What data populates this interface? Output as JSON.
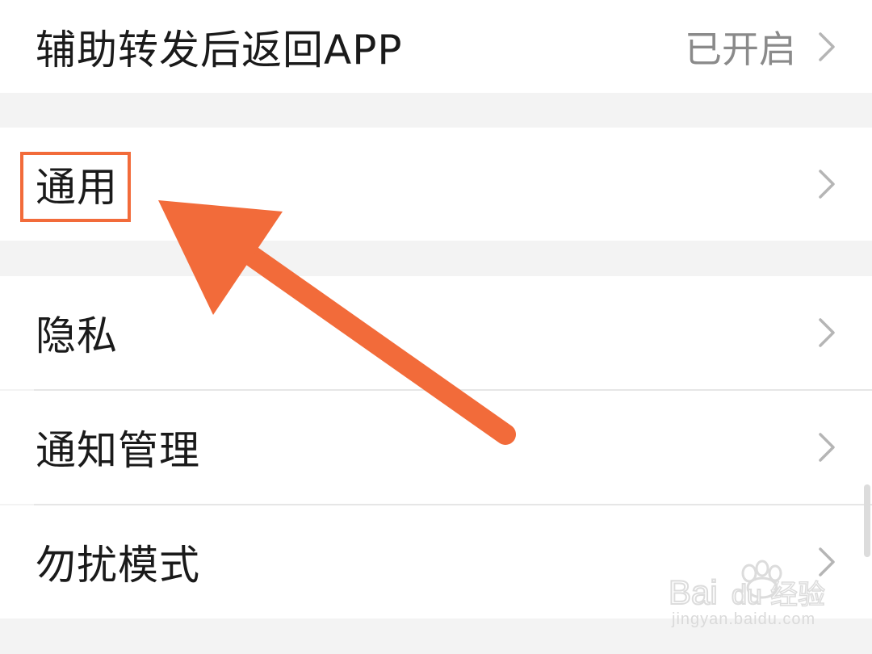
{
  "rows": {
    "assist_forward": {
      "label": "辅助转发后返回APP",
      "value": "已开启"
    },
    "general": {
      "label": "通用"
    },
    "privacy": {
      "label": "隐私"
    },
    "notifications": {
      "label": "通知管理"
    },
    "dnd": {
      "label": "勿扰模式"
    }
  },
  "annotation": {
    "color": "#f26b3a"
  },
  "watermark": {
    "logo_text": "Baidu经验",
    "url": "jingyan.baidu.com"
  },
  "icons": {
    "chevron": "chevron-right-icon"
  }
}
